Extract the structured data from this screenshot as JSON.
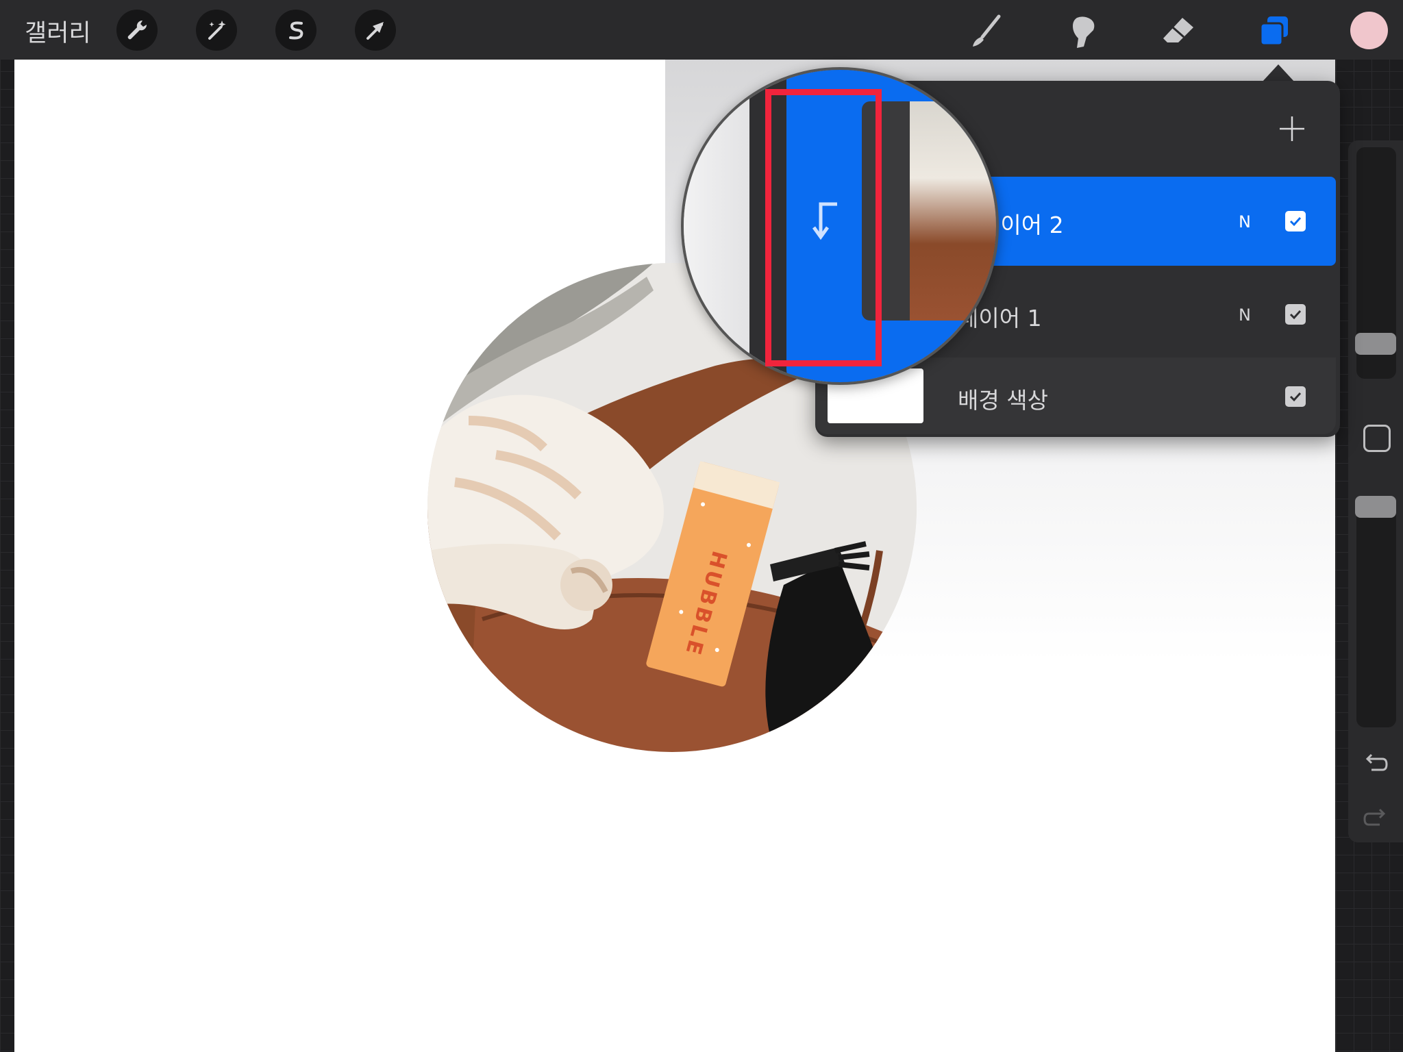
{
  "topbar": {
    "gallery_label": "갤러리",
    "left_tools": [
      "wrench-icon",
      "magic-wand-icon",
      "selection-s-icon",
      "transform-arrow-icon"
    ],
    "right_tools": [
      "brush-icon",
      "smudge-icon",
      "eraser-icon",
      "layers-icon"
    ],
    "active_color": "#f0c6cc",
    "accent": "#0a6cf0"
  },
  "layers_panel": {
    "add_icon": "plus-icon",
    "layers": [
      {
        "name": "레이어 2",
        "blend": "N",
        "visible": true,
        "selected": true,
        "clipping": true
      },
      {
        "name": "레이어 1",
        "blend": "N",
        "visible": true,
        "selected": false
      },
      {
        "name": "배경 색상",
        "visible": true,
        "selected": false
      }
    ]
  },
  "magnifier": {
    "clipping_indicator_icon": "clipping-mask-arrow-icon",
    "highlight_color": "#f1243c"
  },
  "sidebar": {
    "undo_icon": "undo-icon",
    "redo_icon": "redo-icon"
  },
  "photo": {
    "box_text": "HUBBLE"
  }
}
